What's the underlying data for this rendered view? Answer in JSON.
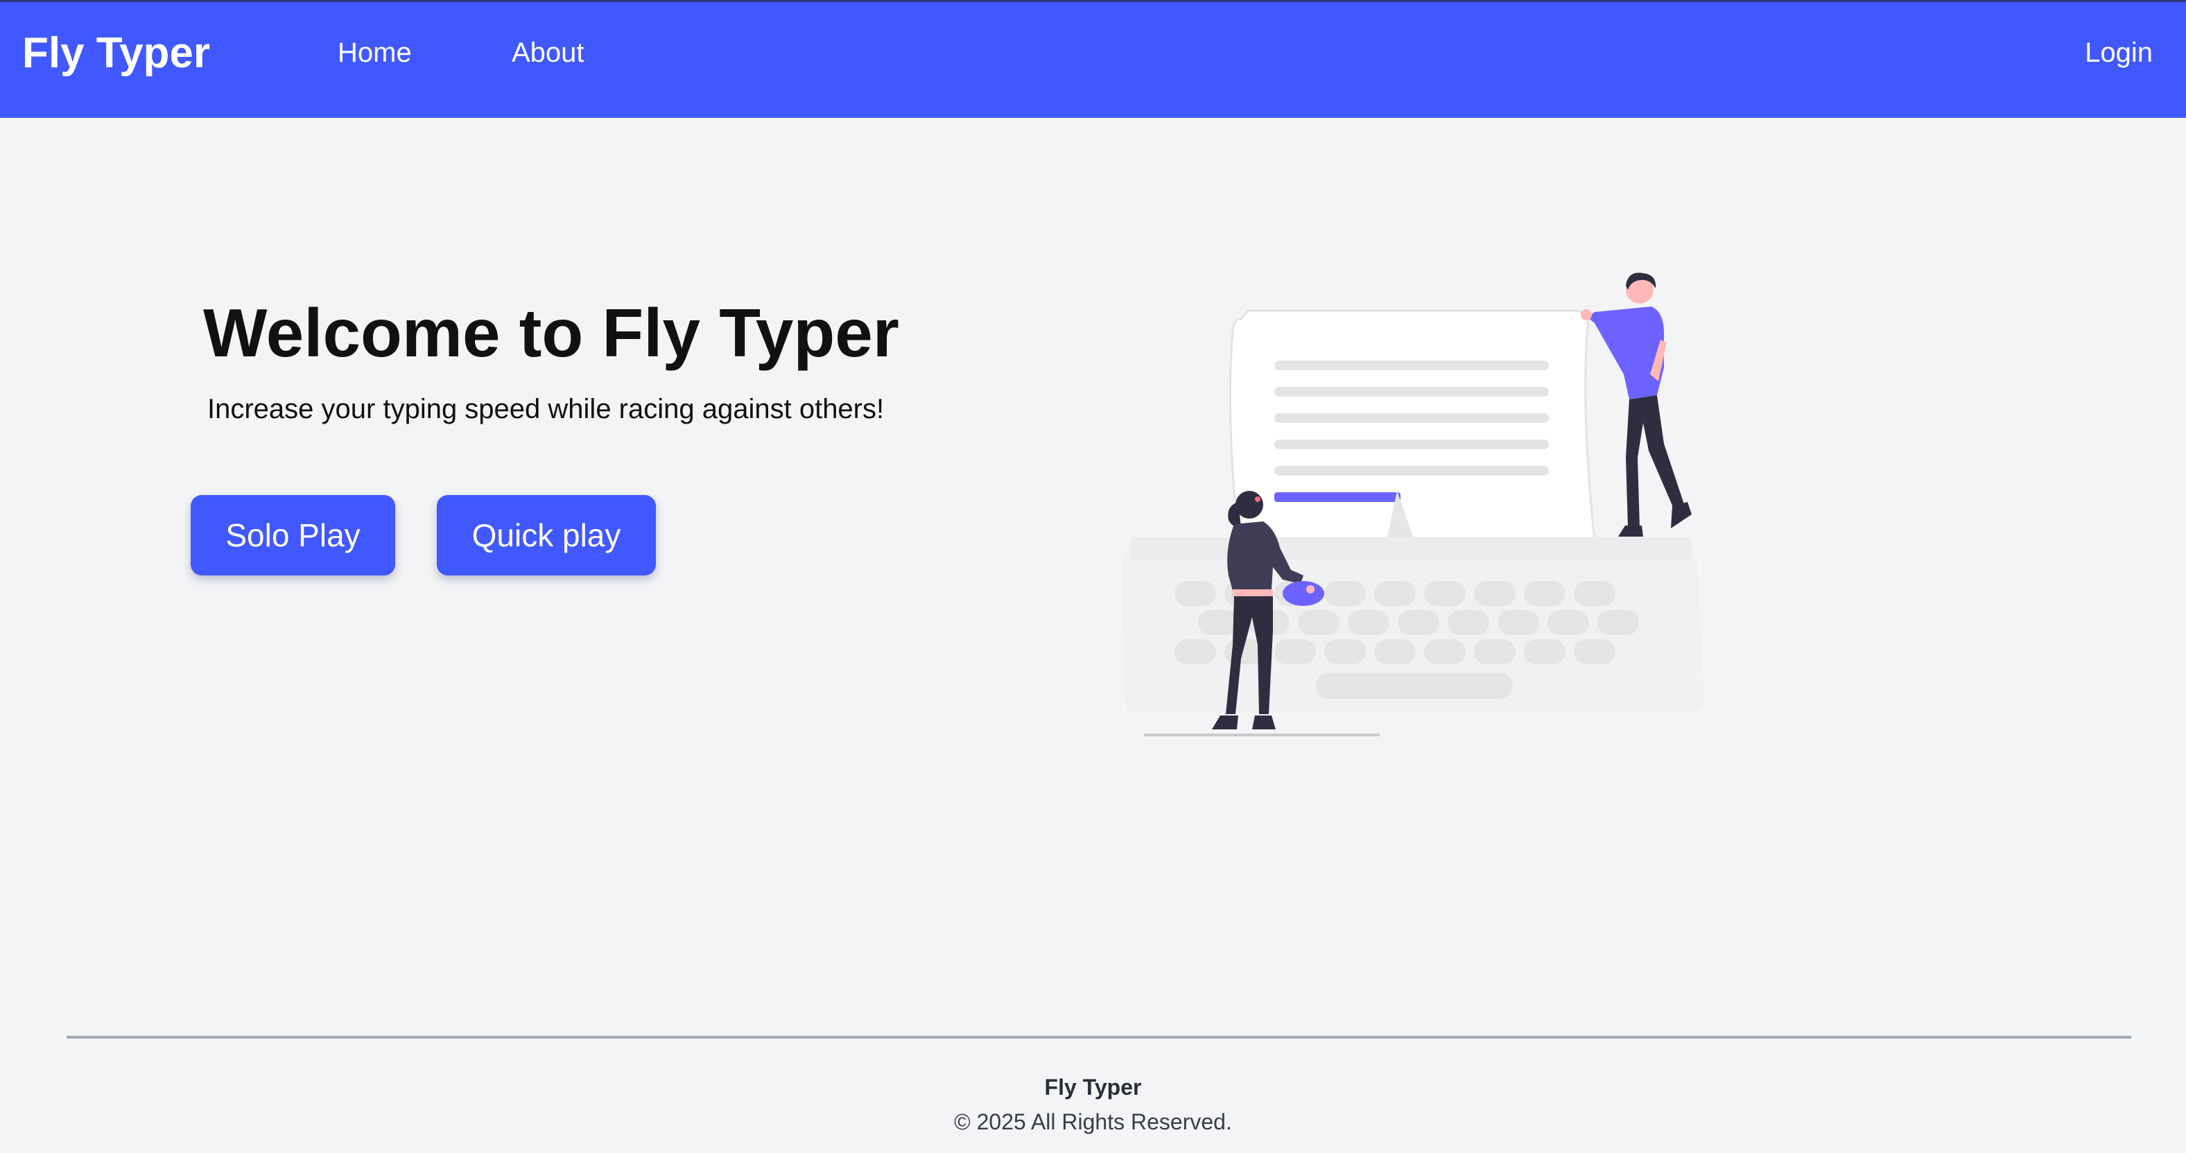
{
  "navbar": {
    "brand": "Fly Typer",
    "links": [
      {
        "label": "Home"
      },
      {
        "label": "About"
      }
    ],
    "login_label": "Login",
    "background_color": "#4158ff"
  },
  "hero": {
    "title": "Welcome to Fly Typer",
    "subtitle": "Increase your typing speed while racing against others!",
    "buttons": {
      "solo_label": "Solo Play",
      "quick_label": "Quick play"
    },
    "illustration_icon": "typewriter-people-illustration",
    "accent_color": "#6c63ff"
  },
  "footer": {
    "brand": "Fly Typer",
    "copyright": "© 2025 All Rights Reserved."
  }
}
